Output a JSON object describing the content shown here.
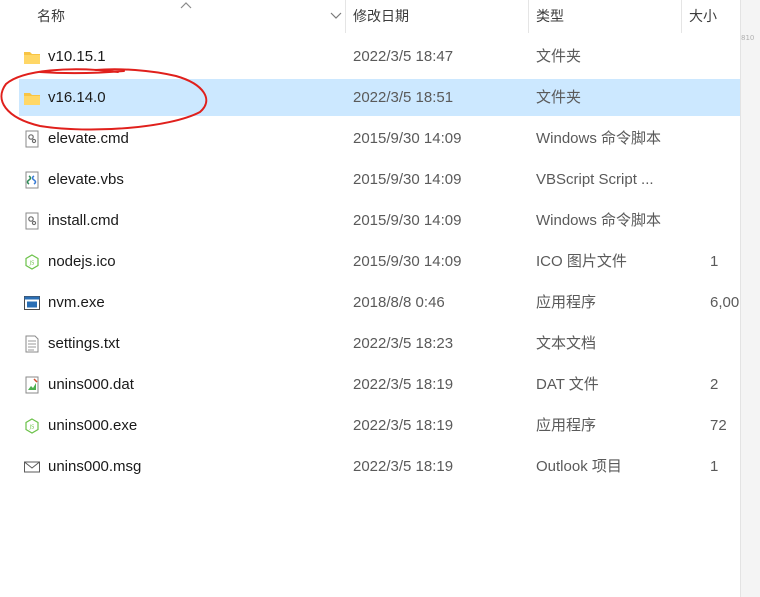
{
  "columns": {
    "name": "名称",
    "date_modified": "修改日期",
    "type": "类型",
    "size": "大小"
  },
  "files": [
    {
      "name": "v10.15.1",
      "date": "2022/3/5 18:47",
      "type": "文件夹",
      "size": "",
      "icon": "folder-icon",
      "selected": false
    },
    {
      "name": "v16.14.0",
      "date": "2022/3/5 18:51",
      "type": "文件夹",
      "size": "",
      "icon": "folder-icon",
      "selected": true
    },
    {
      "name": "elevate.cmd",
      "date": "2015/9/30 14:09",
      "type": "Windows 命令脚本",
      "size": "",
      "icon": "cmd-script-icon",
      "selected": false
    },
    {
      "name": "elevate.vbs",
      "date": "2015/9/30 14:09",
      "type": "VBScript Script ...",
      "size": "",
      "icon": "vbs-script-icon",
      "selected": false
    },
    {
      "name": "install.cmd",
      "date": "2015/9/30 14:09",
      "type": "Windows 命令脚本",
      "size": "",
      "icon": "cmd-script-icon",
      "selected": false
    },
    {
      "name": "nodejs.ico",
      "date": "2015/9/30 14:09",
      "type": "ICO 图片文件",
      "size": "1",
      "icon": "nodejs-icon",
      "selected": false
    },
    {
      "name": "nvm.exe",
      "date": "2018/8/8 0:46",
      "type": "应用程序",
      "size": "6,00",
      "icon": "exe-icon",
      "selected": false
    },
    {
      "name": "settings.txt",
      "date": "2022/3/5 18:23",
      "type": "文本文档",
      "size": "",
      "icon": "text-file-icon",
      "selected": false
    },
    {
      "name": "unins000.dat",
      "date": "2022/3/5 18:19",
      "type": "DAT 文件",
      "size": "2",
      "icon": "dat-file-icon",
      "selected": false
    },
    {
      "name": "unins000.exe",
      "date": "2022/3/5 18:19",
      "type": "应用程序",
      "size": "72",
      "icon": "nodejs-icon",
      "selected": false
    },
    {
      "name": "unins000.msg",
      "date": "2022/3/5 18:19",
      "type": "Outlook 项目",
      "size": "1",
      "icon": "mail-icon",
      "selected": false
    }
  ],
  "side_strip_text": "810",
  "colors": {
    "selection": "#cce8ff",
    "folder": "#f8c444",
    "annotation": "#e0201c"
  }
}
